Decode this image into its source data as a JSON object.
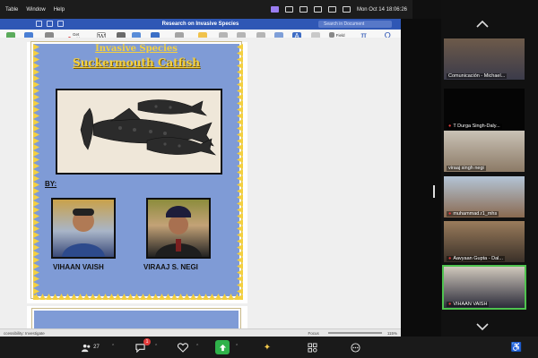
{
  "menubar": {
    "items": [
      "Table",
      "Window",
      "Help"
    ],
    "clock": "Mon Oct 14  18:06:26"
  },
  "document": {
    "title": "Research on Invasive Species",
    "search_placeholder": "Search in Document",
    "ribbon": {
      "buttons": [
        "SmartArt",
        "Chart",
        "Screenshot",
        "Get Add-ins",
        "My Add-ins",
        "Wikipedia",
        "Media",
        "Link",
        "Bookmark",
        "Cross-reference",
        "Comment",
        "Header",
        "Footer",
        "Page Number",
        "Text Box",
        "WordArt",
        "Drop Cap",
        "Field",
        "Date & Time",
        "Object",
        "Equation",
        "Advanced Symbol"
      ],
      "accent_color": "#2f57b5"
    },
    "poster": {
      "title_line1": "Invasive Species",
      "title_line2": "Suckermouth Catfish",
      "by_label": "BY:",
      "students": [
        "VIHAAN VAISH",
        "VIRAAJ S. NEGI"
      ],
      "background_color": "#7f9bd6",
      "title_color": "#f4d03f"
    },
    "statusbar": {
      "left": "ccessibility: Investigate",
      "focus": "Focus",
      "zoom": "115%"
    }
  },
  "participants": [
    {
      "name": "Comunicación - Michael...",
      "muted": false,
      "icon": "gallery"
    },
    {
      "name": "T Durga Singh-Daly...",
      "muted": true,
      "icon": "camera-off"
    },
    {
      "name": "viraaj singh negi",
      "muted": false,
      "icon": "video"
    },
    {
      "name": "muhammad.r1_mhs",
      "muted": true,
      "icon": "video"
    },
    {
      "name": "Aavyaan Gupta - Dal...",
      "muted": true,
      "icon": "video"
    },
    {
      "name": "VIHAAN VAISH",
      "muted": true,
      "icon": "video",
      "active": true
    }
  ],
  "zoombar": {
    "participants_count": "27",
    "chat_badge": "1"
  }
}
